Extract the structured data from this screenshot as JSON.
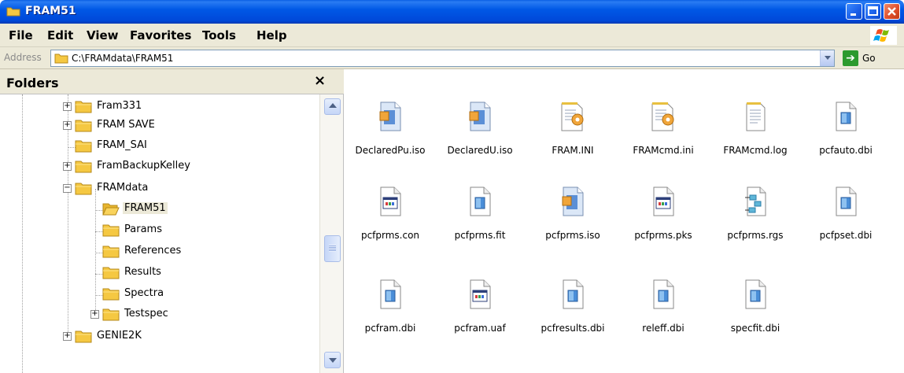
{
  "window": {
    "title": "FRAM51"
  },
  "menu": {
    "items": [
      "File",
      "Edit",
      "View",
      "Favorites",
      "Tools",
      "Help"
    ]
  },
  "address": {
    "label": "Address",
    "value": "C:\\FRAMdata\\FRAM51",
    "go_label": "Go"
  },
  "folders": {
    "title": "Folders",
    "close_glyph": "×",
    "items": [
      {
        "label": "Fram331",
        "expander": "+",
        "selected": false
      },
      {
        "label": "FRAM SAVE",
        "expander": "+",
        "selected": false
      },
      {
        "label": "FRAM_SAI",
        "expander": "",
        "selected": false
      },
      {
        "label": "FramBackupKelley",
        "expander": "+",
        "selected": false
      },
      {
        "label": "FRAMdata",
        "expander": "−",
        "selected": false
      },
      {
        "label": "FRAM51",
        "expander": "",
        "selected": true
      },
      {
        "label": "Params",
        "expander": "",
        "selected": false
      },
      {
        "label": "References",
        "expander": "",
        "selected": false
      },
      {
        "label": "Results",
        "expander": "",
        "selected": false
      },
      {
        "label": "Spectra",
        "expander": "",
        "selected": false
      },
      {
        "label": "Testspec",
        "expander": "+",
        "selected": false
      },
      {
        "label": "GENIE2K",
        "expander": "+",
        "selected": false
      }
    ]
  },
  "files": [
    {
      "name": "DeclaredPu.iso",
      "icon": "iso-file-icon"
    },
    {
      "name": "DeclaredU.iso",
      "icon": "iso-file-icon"
    },
    {
      "name": "FRAM.INI",
      "icon": "ini-settings-icon"
    },
    {
      "name": "FRAMcmd.ini",
      "icon": "ini-settings-icon"
    },
    {
      "name": "FRAMcmd.log",
      "icon": "text-document-icon"
    },
    {
      "name": "pcfauto.dbi",
      "icon": "generic-file-icon"
    },
    {
      "name": "pcfprms.con",
      "icon": "program-window-file-icon"
    },
    {
      "name": "pcfprms.fit",
      "icon": "generic-file-icon"
    },
    {
      "name": "pcfprms.iso",
      "icon": "iso-file-icon"
    },
    {
      "name": "pcfprms.pks",
      "icon": "program-window-file-icon"
    },
    {
      "name": "pcfprms.rgs",
      "icon": "registry-file-icon"
    },
    {
      "name": "pcfpset.dbi",
      "icon": "generic-file-icon"
    },
    {
      "name": "pcfram.dbi",
      "icon": "generic-file-icon"
    },
    {
      "name": "pcfram.uaf",
      "icon": "program-window-file-icon"
    },
    {
      "name": "pcfresults.dbi",
      "icon": "generic-file-icon"
    },
    {
      "name": "releff.dbi",
      "icon": "generic-file-icon"
    },
    {
      "name": "specfit.dbi",
      "icon": "generic-file-icon"
    }
  ],
  "colors": {
    "titlebar": "#0058e6",
    "chrome": "#ece9d8",
    "folder": "#f5c842"
  }
}
